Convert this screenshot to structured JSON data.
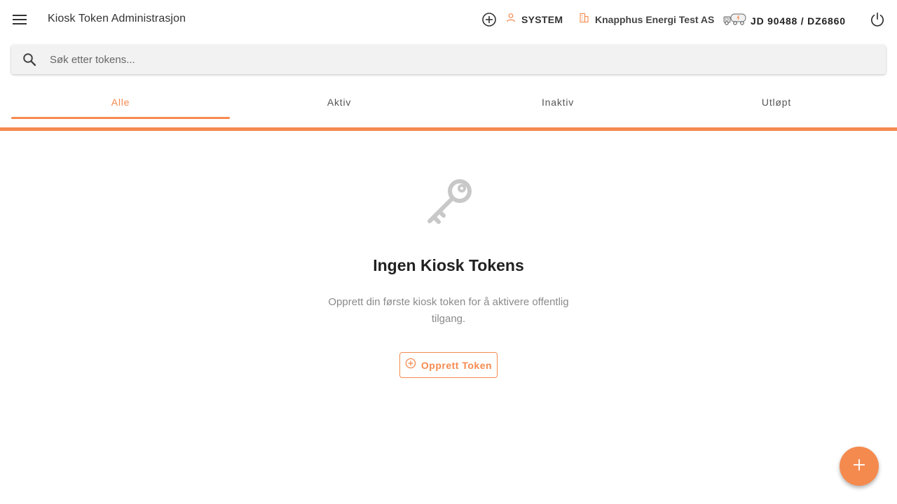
{
  "header": {
    "title": "Kiosk Token Administrasjon",
    "user": "SYSTEM",
    "company": "Knapphus Energi Test AS",
    "vehicle": "JD 90488 / DZ6860"
  },
  "search": {
    "placeholder": "Søk etter tokens..."
  },
  "tabs": [
    {
      "label": "Alle",
      "active": true
    },
    {
      "label": "Aktiv",
      "active": false
    },
    {
      "label": "Inaktiv",
      "active": false
    },
    {
      "label": "Utløpt",
      "active": false
    }
  ],
  "empty_state": {
    "icon": "key-icon",
    "title": "Ingen Kiosk Tokens",
    "description": "Opprett din første kiosk token for å aktivere offentlig tilgang.",
    "button_label": "Opprett Token"
  },
  "colors": {
    "accent": "#f58a4f",
    "text": "#212121",
    "muted": "#8a8a8a",
    "icon_gray": "#c8c8c8"
  }
}
